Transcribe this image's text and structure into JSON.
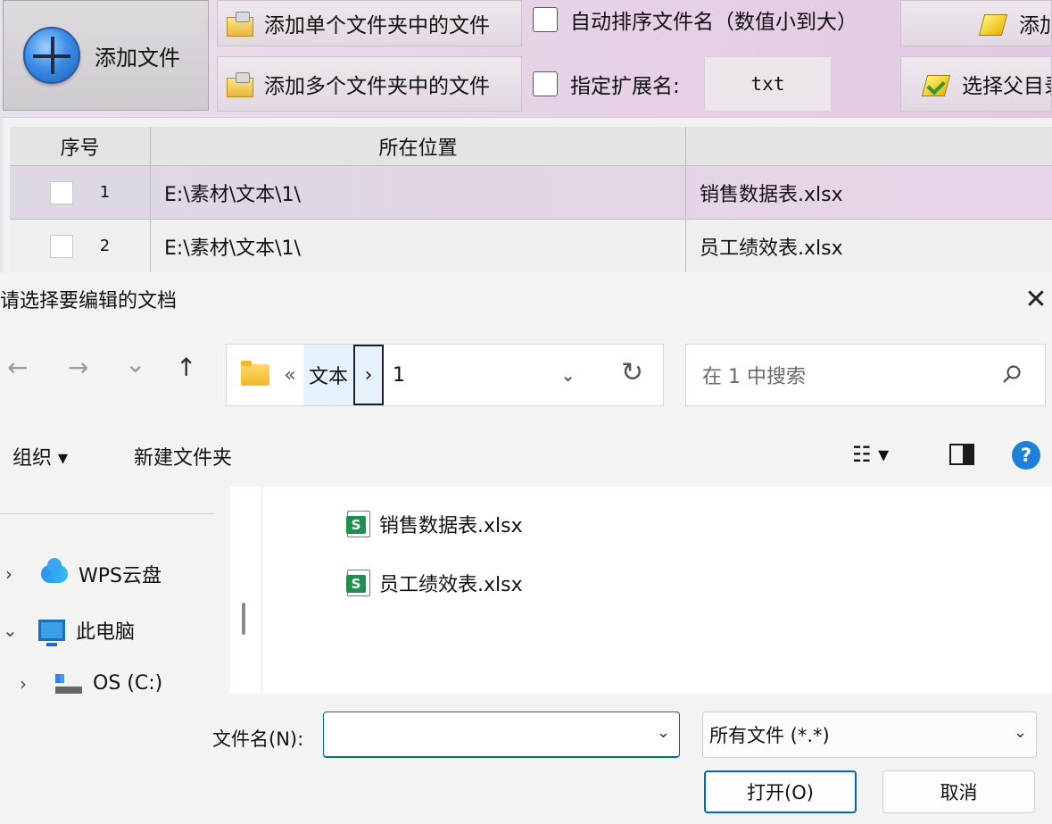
{
  "app": {
    "add_file_label": "添加文件",
    "add_single_folder_label": "添加单个文件夹中的文件",
    "add_multi_folder_label": "添加多个文件夹中的文件",
    "auto_sort_label": "自动排序文件名（数值小到大）",
    "ext_label": "指定扩展名:",
    "ext_value": "txt",
    "right_btn_top_label": "添加",
    "right_btn_bottom_label": "选择父目录",
    "table": {
      "headers": [
        "序号",
        "所在位置",
        ""
      ],
      "rows": [
        {
          "index": "1",
          "location": "E:\\素材\\文本\\1\\",
          "name": "销售数据表.xlsx"
        },
        {
          "index": "2",
          "location": "E:\\素材\\文本\\1\\",
          "name": "员工绩效表.xlsx"
        }
      ]
    }
  },
  "dialog": {
    "title": "请选择要编辑的文档",
    "close_glyph": "✕",
    "nav": {
      "back": "←",
      "forward": "→",
      "recent": "⌄",
      "up": "↑"
    },
    "breadcrumb": {
      "overflow": "«",
      "parent": "文本",
      "separator": "›",
      "current": "1"
    },
    "address_dropdown": "⌄",
    "refresh_glyph": "↻",
    "search_placeholder": "在 1 中搜索",
    "toolbar": {
      "organize": "组织 ▾",
      "new_folder": "新建文件夹",
      "view_glyph": "☷ ▾",
      "help": "?"
    },
    "tree": [
      {
        "chevron": "›",
        "label": "WPS云盘",
        "icon": "cloud-icon"
      },
      {
        "chevron": "⌄",
        "label": "此电脑",
        "icon": "computer-icon"
      },
      {
        "chevron": "›",
        "label": "OS (C:)",
        "icon": "drive-icon"
      }
    ],
    "files": [
      {
        "name": "销售数据表.xlsx",
        "icon": "spreadsheet-icon"
      },
      {
        "name": "员工绩效表.xlsx",
        "icon": "spreadsheet-icon"
      }
    ],
    "filename_label": "文件名(N):",
    "filename_value": "",
    "dropdown_glyph": "⌄",
    "file_type": "所有文件 (*.*)",
    "open_label": "打开(O)",
    "cancel_label": "取消"
  },
  "colors": {
    "accent": "#0067c0",
    "app_bg": "#e6d2e6",
    "excel_green": "#1f8f50"
  }
}
